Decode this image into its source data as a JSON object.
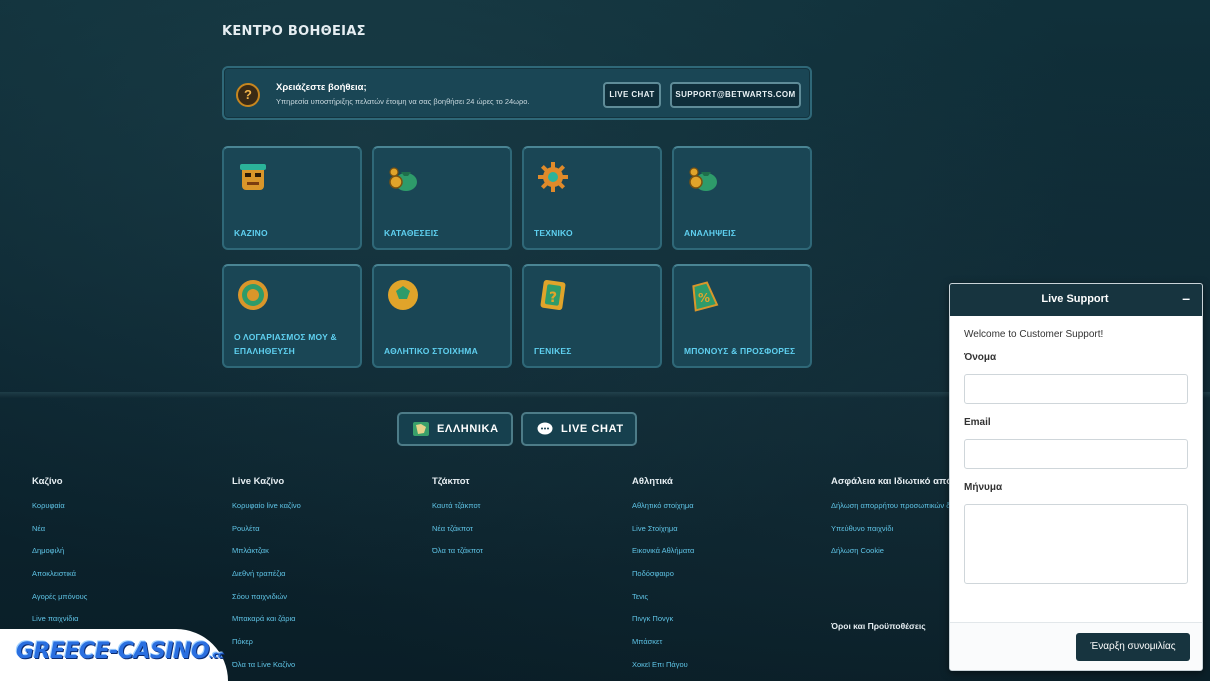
{
  "page_title": "ΚΕΝΤΡΟ ΒΟΗΘΕΙΑΣ",
  "help_banner": {
    "icon": "question-mark-icon",
    "title": "Χρειάζεστε βοήθεια;",
    "subtitle": "Υπηρεσία υποστήριξης πελατών έτοιμη να σας βοηθήσει 24 ώρες το 24ωρο.",
    "live_chat_label": "LIVE CHAT",
    "email_label": "SUPPORT@BETWARTS.COM"
  },
  "categories": [
    {
      "label": "ΚΑΖΙΝΟ",
      "icon": "mask-icon"
    },
    {
      "label": "ΚΑΤΑΘΕΣΕΙΣ",
      "icon": "money-bag-icon"
    },
    {
      "label": "ΤΕΧΝΙΚΟ",
      "icon": "gear-icon"
    },
    {
      "label": "ΑΝΑΛΗΨΕΙΣ",
      "icon": "money-bag-icon"
    },
    {
      "label": "Ο ΛΟΓΑΡΙΑΣΜΟΣ ΜΟΥ & ΕΠΑΛΗΘΕΥΣΗ",
      "icon": "medallion-icon"
    },
    {
      "label": "ΑΘΛΗΤΙΚΟ ΣΤΟΙΧΗΜΑ",
      "icon": "ball-icon"
    },
    {
      "label": "ΓΕΝΙΚΕΣ",
      "icon": "question-card-icon"
    },
    {
      "label": "ΜΠΟΝΟΥΣ & ΠΡΟΣΦΟΡΕΣ",
      "icon": "percent-tag-icon"
    }
  ],
  "buttons": {
    "language": "ΕΛΛΗΝΙΚΑ",
    "live_chat": "LIVE CHAT"
  },
  "footer": [
    {
      "heading": "Καζίνο",
      "links": [
        "Κορυφαία",
        "Νέα",
        "Δημοφιλή",
        "Αποκλειστικά",
        "Αγορές μπόνους",
        "Live παιχνίδια"
      ]
    },
    {
      "heading": "Live Καζίνο",
      "links": [
        "Κορυφαίο live καζίνο",
        "Ρουλέτα",
        "Μπλάκτζακ",
        "Διεθνή τραπέζια",
        "Σόου παιχνιδιών",
        "Μπακαρά και ζάρια",
        "Πόκερ",
        "Όλα τα Live Καζίνο"
      ]
    },
    {
      "heading": "Τζάκποτ",
      "links": [
        "Καυτά τζάκποτ",
        "Νέα τζάκποτ",
        "Όλα τα τζάκποτ"
      ]
    },
    {
      "heading": "Αθλητικά",
      "links": [
        "Αθλητικό στοίχημα",
        "Live Στοίχημα",
        "Εικονικά Αθλήματα",
        "Ποδόσφαιρο",
        "Τενις",
        "Πινγκ Πονγκ",
        "Μπάσκετ",
        "Χοκεϊ Επι Πάγου"
      ]
    },
    {
      "heading": "Ασφάλεια και Ιδιωτικό απόρρ",
      "links": [
        "Δήλωση απορρήτου προσωπικών δ",
        "Υπεύθυνο παιχνίδι",
        "Δήλωση Cookie"
      ]
    }
  ],
  "terms_label": "Όροι και Προϋποθέσεις",
  "logo": {
    "text": "GREECE-CASINO",
    "tld": ".cc"
  },
  "chat": {
    "title": "Live Support",
    "minimize": "–",
    "welcome": "Welcome to Customer Support!",
    "name_label": "Όνομα",
    "email_label": "Email",
    "message_label": "Μήνυμα",
    "submit_label": "Έναρξη συνομιλίας"
  }
}
